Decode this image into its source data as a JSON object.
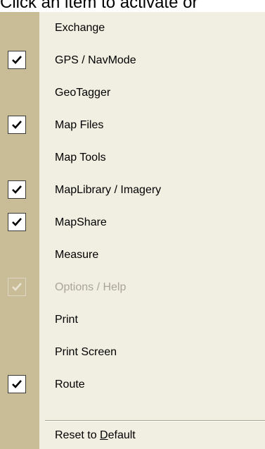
{
  "instruction_text": "Click an item to activate or",
  "menu": {
    "items": [
      {
        "label": "Exchange",
        "checked": false,
        "enabled": true
      },
      {
        "label": "GPS / NavMode",
        "checked": true,
        "enabled": true
      },
      {
        "label": "GeoTagger",
        "checked": false,
        "enabled": true
      },
      {
        "label": "Map Files",
        "checked": true,
        "enabled": true
      },
      {
        "label": "Map Tools",
        "checked": false,
        "enabled": true
      },
      {
        "label": "MapLibrary / Imagery",
        "checked": true,
        "enabled": true
      },
      {
        "label": "MapShare",
        "checked": true,
        "enabled": true
      },
      {
        "label": "Measure",
        "checked": false,
        "enabled": true
      },
      {
        "label": "Options / Help",
        "checked": true,
        "enabled": false
      },
      {
        "label": "Print",
        "checked": false,
        "enabled": true
      },
      {
        "label": "Print Screen",
        "checked": false,
        "enabled": true
      },
      {
        "label": "Route",
        "checked": true,
        "enabled": true
      }
    ],
    "reset": {
      "label_prefix": "Reset to ",
      "label_accel": "D",
      "label_suffix": "efault"
    }
  },
  "colors": {
    "menu_background": "#f1efe2",
    "gutter": "#c8bd97",
    "disabled_text": "#a9a697"
  },
  "icons": {
    "check": "checkmark-icon"
  }
}
